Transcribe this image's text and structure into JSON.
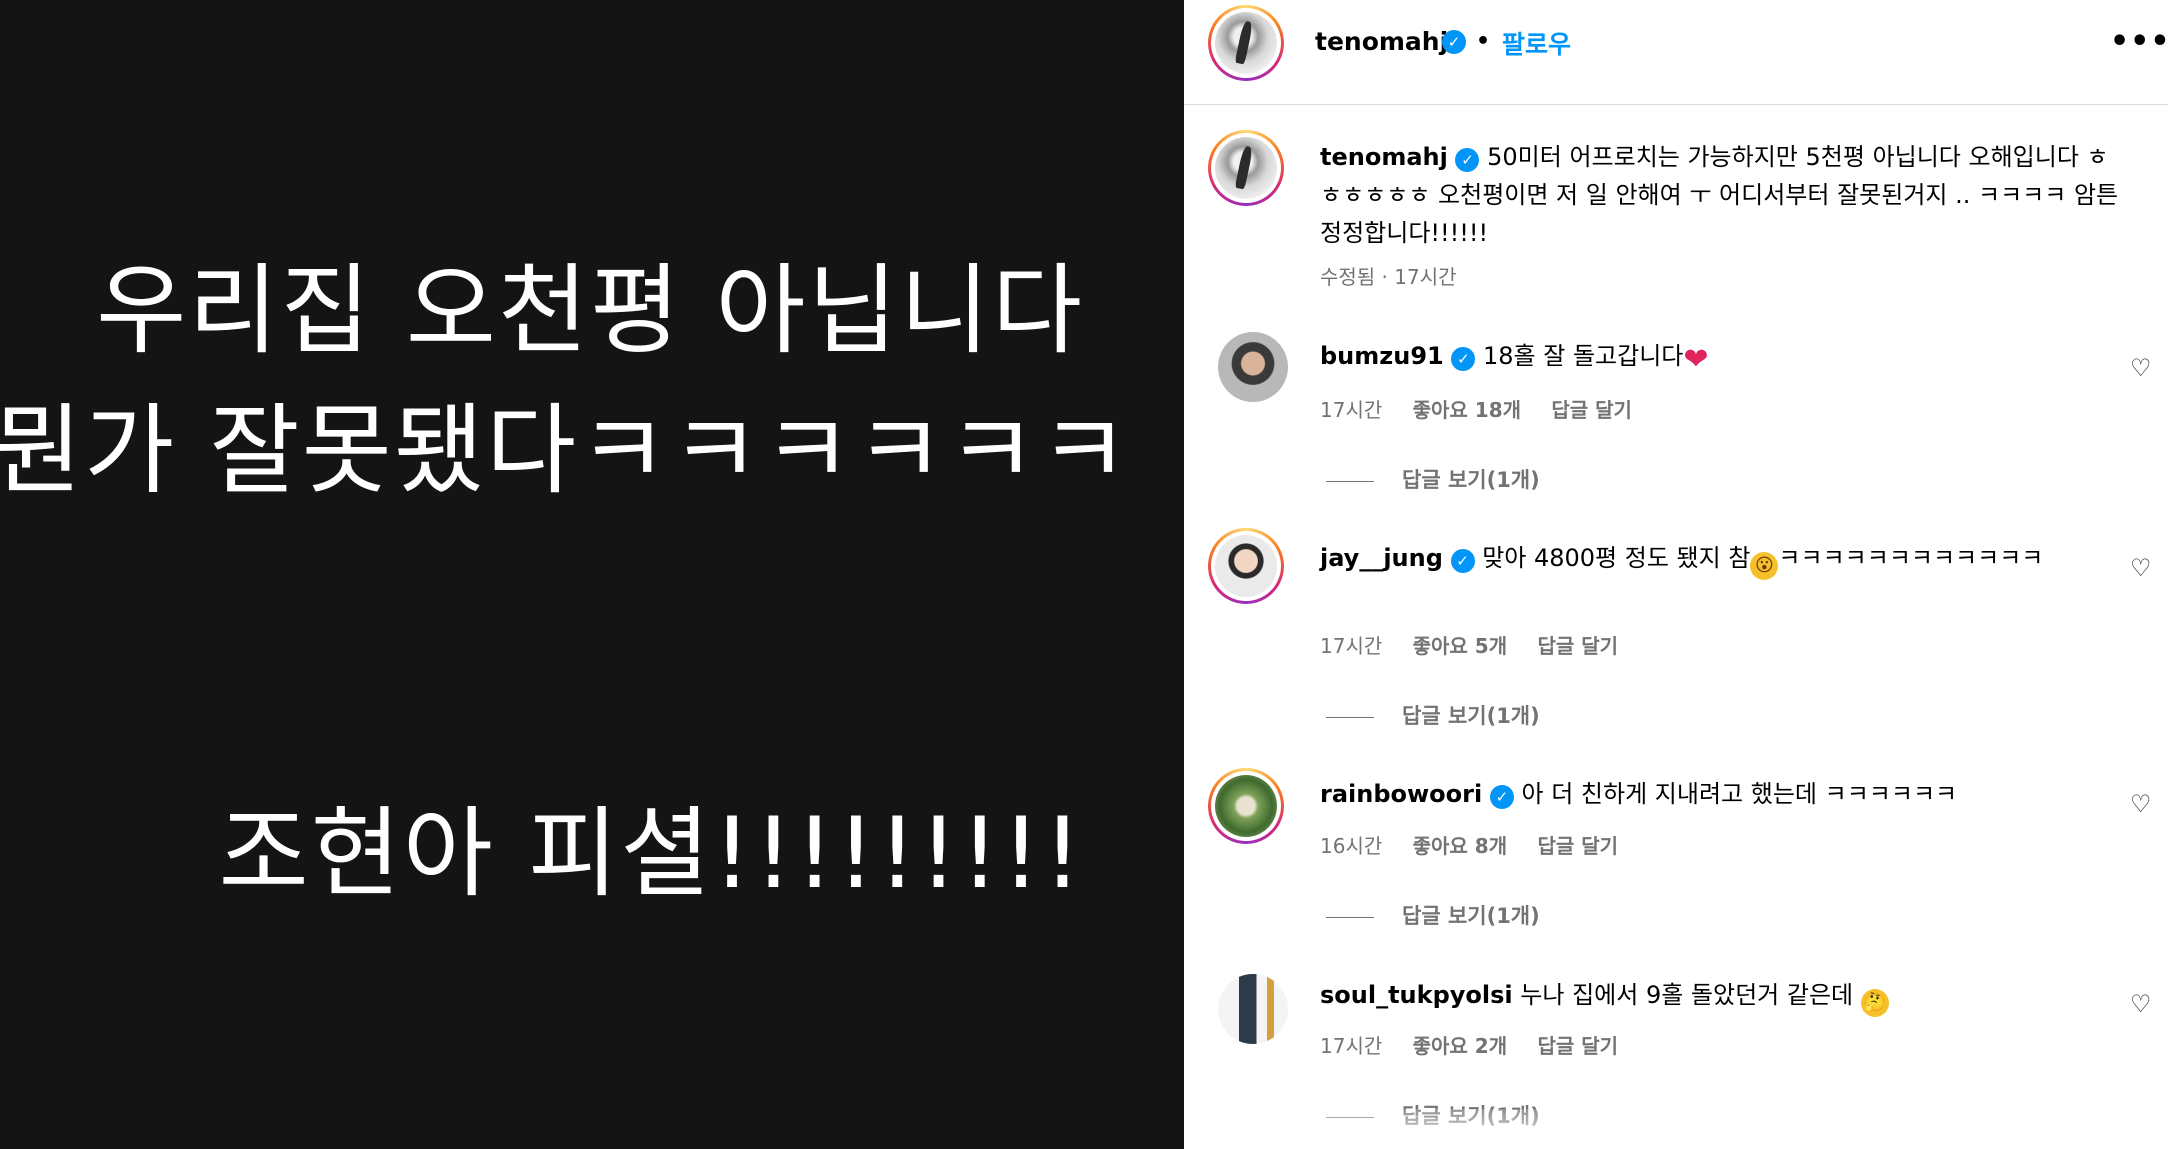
{
  "post_image": {
    "line1": "우리집 오천평 아닙니다",
    "line2": "뭔가 잘못됐다ㅋㅋㅋㅋㅋㅋ",
    "line3": "조현아 피셜!!!!!!!!!"
  },
  "header": {
    "username": "tenomahj",
    "verified_mark": "✓",
    "separator": "•",
    "follow_label": "팔로우",
    "more_label": "•••"
  },
  "caption": {
    "username": "tenomahj",
    "verified_mark": "✓",
    "text": "50미터 어프로치는 가능하지만 5천평 아닙니다 오해입니다 ㅎㅎㅎㅎㅎㅎ 오천평이면 저 일 안해여 ㅜ 어디서부터 잘못된거지 .. ㅋㅋㅋㅋ 암튼 정정합니다!!!!!!",
    "meta": "수정됨 · 17시간"
  },
  "comments": [
    {
      "username": "bumzu91",
      "verified_mark": "✓",
      "text": "18홀 잘 돌고갑니다",
      "emoji": "❤",
      "time": "17시간",
      "likes": "좋아요 18개",
      "reply": "답글 달기",
      "view_replies": "답글 보기(1개)"
    },
    {
      "username": "jay__jung",
      "verified_mark": "✓",
      "text": "맞아 4800평 정도 됐지 참",
      "emoji": "😮",
      "text_after": "ㅋㅋㅋㅋㅋㅋㅋㅋㅋㅋㅋㅋ",
      "time": "17시간",
      "likes": "좋아요 5개",
      "reply": "답글 달기",
      "view_replies": "답글 보기(1개)"
    },
    {
      "username": "rainbowoori",
      "verified_mark": "✓",
      "text": "아 더 친하게 지내려고 했는데 ㅋㅋㅋㅋㅋㅋ",
      "time": "16시간",
      "likes": "좋아요 8개",
      "reply": "답글 달기",
      "view_replies": "답글 보기(1개)"
    },
    {
      "username": "soul_tukpyolsi",
      "text": "누나 집에서 9홀 돌았던거 같은데",
      "emoji": "🤔",
      "time": "17시간",
      "likes": "좋아요 2개",
      "reply": "답글 달기",
      "view_replies": "답글 보기(1개)"
    }
  ],
  "icons": {
    "like": "♡"
  },
  "colors": {
    "accent": "#0095f6",
    "image_bg": "#141414",
    "muted": "#737373"
  }
}
